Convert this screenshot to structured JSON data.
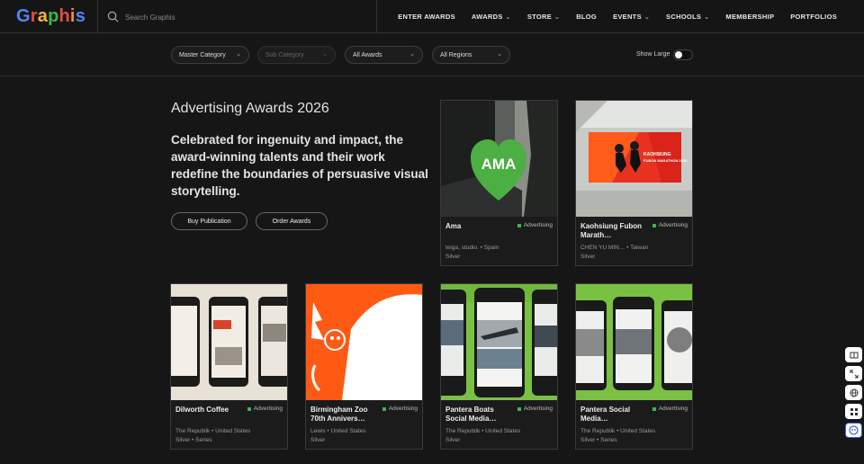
{
  "header": {
    "logo_letters": [
      {
        "ch": "G",
        "color": "#4f86f7"
      },
      {
        "ch": "r",
        "color": "#e94b3c"
      },
      {
        "ch": "a",
        "color": "#f2b632"
      },
      {
        "ch": "p",
        "color": "#3db54a"
      },
      {
        "ch": "h",
        "color": "#e94b3c"
      },
      {
        "ch": "i",
        "color": "#f28a30"
      },
      {
        "ch": "s",
        "color": "#4f86f7"
      }
    ],
    "search_placeholder": "Search Graphis",
    "nav": [
      {
        "label": "ENTER AWARDS",
        "dropdown": false
      },
      {
        "label": "AWARDS",
        "dropdown": true
      },
      {
        "label": "STORE",
        "dropdown": true
      },
      {
        "label": "BLOG",
        "dropdown": false
      },
      {
        "label": "EVENTS",
        "dropdown": true
      },
      {
        "label": "SCHOOLS",
        "dropdown": true
      },
      {
        "label": "MEMBERSHIP",
        "dropdown": false
      },
      {
        "label": "PORTFOLIOS",
        "dropdown": false
      }
    ]
  },
  "filters": {
    "master_category": "Master Category",
    "sub_category": "Sub Category",
    "all_awards": "All Awards",
    "all_regions": "All Regions",
    "show_large": "Show Large"
  },
  "hero": {
    "title": "Advertising Awards 2026",
    "description": "Celebrated for ingenuity and impact, the award-winning talents and their work redefine the boundaries of persuasive visual storytelling.",
    "buy_label": "Buy Publication",
    "order_label": "Order Awards"
  },
  "cards": [
    {
      "title": "Ama",
      "category": "Advertising",
      "by": "teiga, studio. • Spain",
      "award": "Silver"
    },
    {
      "title": "Kaohsiung Fubon Marath…",
      "category": "Advertising",
      "by": "CHEN YU MIN… • Taiwan",
      "award": "Silver"
    },
    {
      "title": "Dilworth Coffee",
      "category": "Advertising",
      "by": "The Republik • United States",
      "award": "Silver • Series"
    },
    {
      "title": "Birmingham Zoo 70th Annivers…",
      "category": "Advertising",
      "by": "Lewis • United States",
      "award": "Silver"
    },
    {
      "title": "Pantera Boats Social Media…",
      "category": "Advertising",
      "by": "The Republik • United States",
      "award": "Silver"
    },
    {
      "title": "Pantera Social Media…",
      "category": "Advertising",
      "by": "The Republik • United States",
      "award": "Silver • Series"
    }
  ],
  "thumb_text": {
    "ama_logo": "AMA",
    "marathon_line1": "KAOHSIUNG",
    "marathon_line2": "FUBON MARATHON 2026"
  },
  "colors": {
    "background": "#161616",
    "accent_green": "#3bb54a",
    "zoo_orange": "#ff5a14",
    "pantera_green": "#7ac143"
  }
}
